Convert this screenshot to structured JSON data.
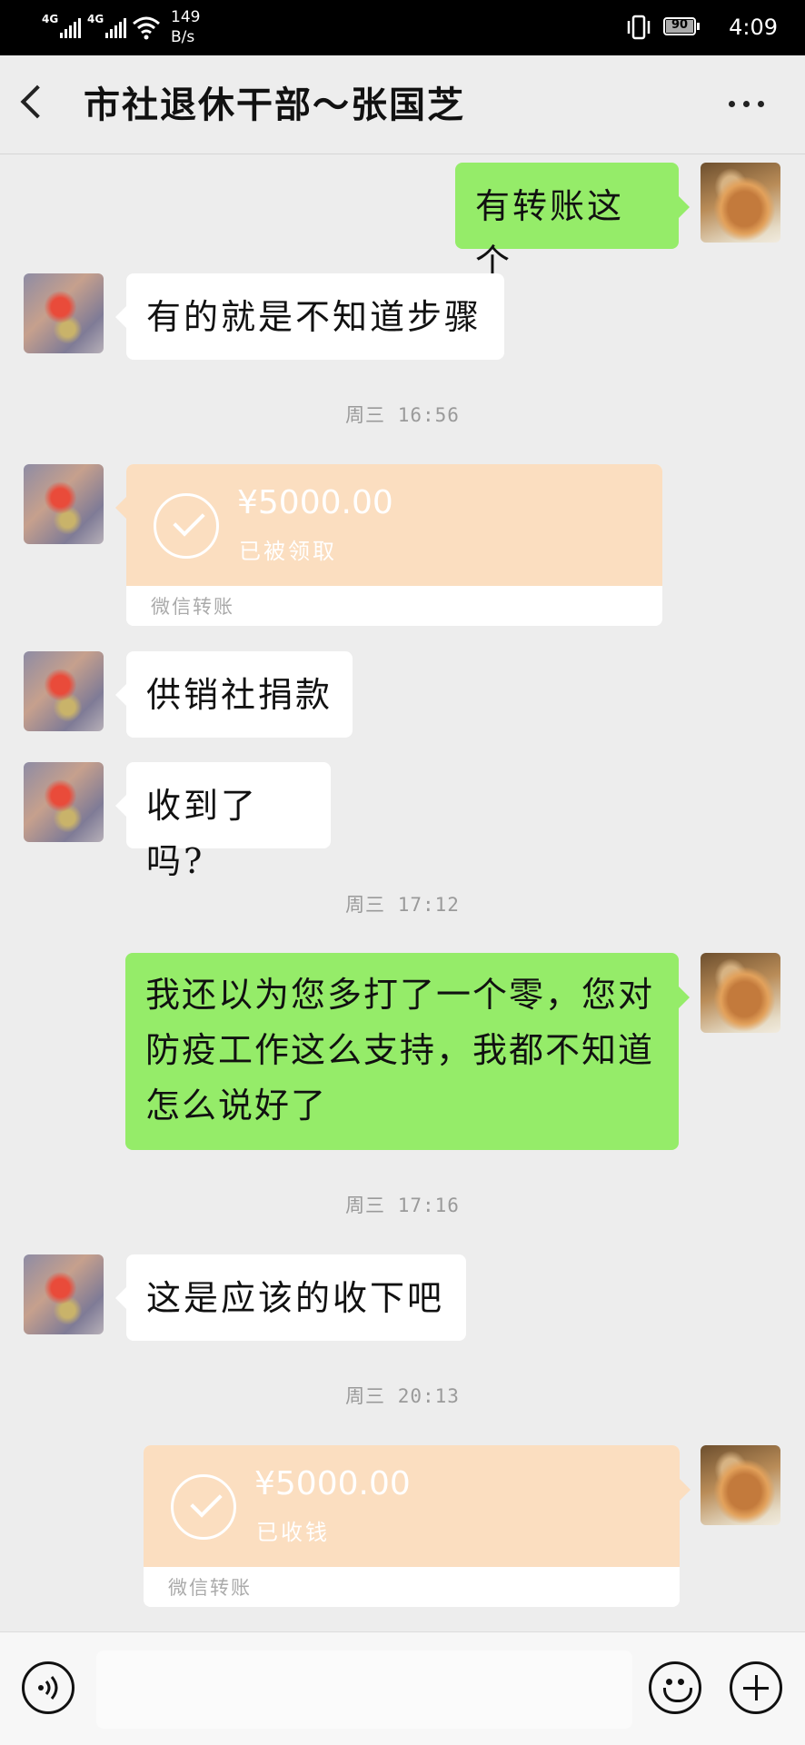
{
  "status_bar": {
    "signal1_label": "4G",
    "signal2_label": "4G",
    "net_speed_value": "149",
    "net_speed_unit": "B/s",
    "battery": "90",
    "time": "4:09"
  },
  "header": {
    "title": "市社退休干部～张国芝"
  },
  "messages": [
    {
      "type": "text",
      "from": "me",
      "text": "有转账这个"
    },
    {
      "type": "text",
      "from": "them",
      "text": "有的就是不知道步骤"
    },
    {
      "type": "time",
      "text": "周三 16:56"
    },
    {
      "type": "transfer",
      "from": "them",
      "amount": "¥5000.00",
      "status": "已被领取",
      "footer": "微信转账"
    },
    {
      "type": "text",
      "from": "them",
      "text": "供销社捐款"
    },
    {
      "type": "text",
      "from": "them",
      "text": "收到了吗?"
    },
    {
      "type": "time",
      "text": "周三 17:12"
    },
    {
      "type": "text",
      "from": "me",
      "lines": [
        "我还以为您多打了一个零，您对",
        "防疫工作这么支持，我都不知道",
        "怎么说好了"
      ]
    },
    {
      "type": "time",
      "text": "周三 17:16"
    },
    {
      "type": "text",
      "from": "them",
      "text": "这是应该的收下吧"
    },
    {
      "type": "time",
      "text": "周三 20:13"
    },
    {
      "type": "transfer",
      "from": "me",
      "amount": "¥5000.00",
      "status": "已收钱",
      "footer": "微信转账"
    }
  ],
  "input_bar": {
    "voice_icon": "voice-icon",
    "emoji_icon": "emoji-icon",
    "plus_icon": "plus-icon",
    "input_value": ""
  },
  "colors": {
    "me_bubble": "#95ec69",
    "them_bubble": "#ffffff",
    "transfer_card": "#fbdec0",
    "background": "#ededed"
  }
}
